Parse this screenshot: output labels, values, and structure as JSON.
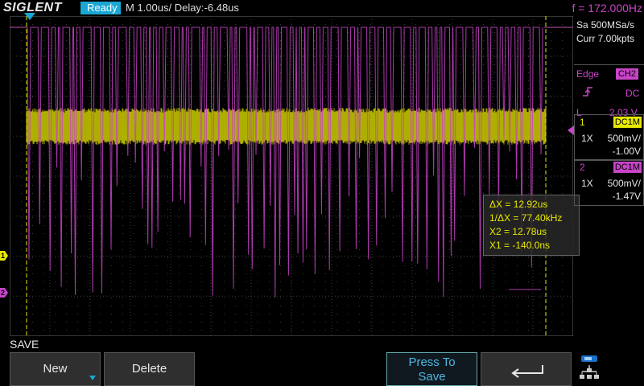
{
  "header": {
    "brand": "SIGLENT",
    "status": "Ready",
    "timebase": "M 1.00us/  Delay:-6.48us",
    "frequency": "f = 172.000Hz"
  },
  "acquisition": {
    "sample_rate": "Sa 500MSa/s",
    "memory": "Curr 7.00kpts"
  },
  "trigger": {
    "type": "Edge",
    "source": "CH2",
    "slope_icon": "rising-edge-icon",
    "coupling": "DC",
    "level_label": "L",
    "level": "2.03 V"
  },
  "channels": [
    {
      "num": "1",
      "coupling": "DC1M",
      "probe": "1X",
      "scale": "500mV/",
      "offset": "-1.00V",
      "color": "#e8e800"
    },
    {
      "num": "2",
      "coupling": "DC1M",
      "probe": "1X",
      "scale": "500mV/",
      "offset": "-1.47V",
      "color": "#c844c8"
    }
  ],
  "markers": {
    "ch1": "1",
    "ch2": "2"
  },
  "cursor": {
    "delta_x": "ΔX = 12.92us",
    "inv_delta_x": "1/ΔX = 77.40kHz",
    "x2": "X2 = 12.78us",
    "x1": "X1 = -140.0ns"
  },
  "menu": {
    "title": "SAVE",
    "new_label": "New",
    "delete_label": "Delete",
    "press_to_save_line1": "Press To",
    "press_to_save_line2": "Save",
    "back_icon": "return-arrow-icon",
    "network_icon": "network-icon"
  },
  "colors": {
    "ch1": "#e8e800",
    "ch2": "#c844c8",
    "accent": "#1aa7d4",
    "cursor": "#e8e800"
  }
}
